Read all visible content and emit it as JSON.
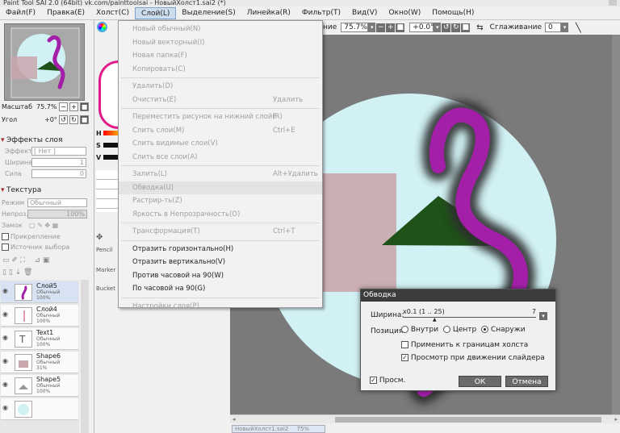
{
  "window": {
    "title": "Paint Tool SAI 2.0 (64bit) vk.com/painttoolsai - НовыйХолст1.sai2 (*)"
  },
  "menubar": [
    "Файл(F)",
    "Правка(E)",
    "Холст(C)",
    "Слой(L)",
    "Выделение(S)",
    "Линейка(R)",
    "Фильтр(T)",
    "Вид(V)",
    "Окно(W)",
    "Помощь(H)"
  ],
  "navigator": {
    "zoom_label": "Масштаб",
    "zoom_value": "75.7%",
    "angle_label": "Угол",
    "angle_value": "+0°"
  },
  "layer_effects": {
    "header": "Эффекты слоя",
    "effect_label": "Эффект",
    "effect_value": "[ Нет ]",
    "width_label": "Ширина",
    "width_value": "1",
    "strength_label": "Сила",
    "strength_value": "0"
  },
  "texture": {
    "header": "Текстура",
    "mode_label": "Режим",
    "mode_value": "Обычный",
    "opacity_label": "Непроз.",
    "opacity_value": "100%",
    "lock_label": "Замок",
    "clip_label": "Прикрепление",
    "source_label": "Источник выбора"
  },
  "layers": [
    {
      "name": "Слой5",
      "mode": "Обычный",
      "opacity": "100%",
      "selected": true
    },
    {
      "name": "Слой4",
      "mode": "Обычный",
      "opacity": "100%",
      "selected": false
    },
    {
      "name": "Text1",
      "mode": "Обычный",
      "opacity": "100%",
      "selected": false
    },
    {
      "name": "Shape6",
      "mode": "Обычный",
      "opacity": "31%",
      "selected": false
    },
    {
      "name": "Shape5",
      "mode": "Обычный",
      "opacity": "100%",
      "selected": false
    }
  ],
  "color_panel": {
    "h": "H",
    "s": "S",
    "v": "V"
  },
  "tool_labels": {
    "pencil": "Pencil",
    "marker": "Marker",
    "bucket": "Bucket"
  },
  "toolbar": {
    "zoom_tail": "ние",
    "zoom_value": "75.7%",
    "angle_value": "+0.0°",
    "smoothing_label": "Сглаживание",
    "smoothing_value": "0"
  },
  "layer_menu": {
    "groups": [
      [
        {
          "label": "Новый обычный(N)",
          "shortcut": "",
          "enabled": false
        },
        {
          "label": "Новый векторный(I)",
          "shortcut": "",
          "enabled": false
        },
        {
          "label": "Новая папка(F)",
          "shortcut": "",
          "enabled": false
        },
        {
          "label": "Копировать(C)",
          "shortcut": "",
          "enabled": false
        }
      ],
      [
        {
          "label": "Удалить(D)",
          "shortcut": "",
          "enabled": false
        },
        {
          "label": "Очистить(E)",
          "shortcut": "Удалить",
          "enabled": false
        }
      ],
      [
        {
          "label": "Переместить рисунок на нижний слой(R)",
          "shortcut": "F",
          "enabled": false
        },
        {
          "label": "Слить слои(M)",
          "shortcut": "Ctrl+E",
          "enabled": false
        },
        {
          "label": "Слить видимые слои(V)",
          "shortcut": "",
          "enabled": false
        },
        {
          "label": "Слить все слои(A)",
          "shortcut": "",
          "enabled": false
        }
      ],
      [
        {
          "label": "Залить(L)",
          "shortcut": "Alt+Удалить",
          "enabled": false
        },
        {
          "label": "Обводка(U)",
          "shortcut": "",
          "enabled": false,
          "hover": true
        },
        {
          "label": "Растрир-ть(Z)",
          "shortcut": "",
          "enabled": false
        },
        {
          "label": "Яркость в Непрозрачность(O)",
          "shortcut": "",
          "enabled": false
        }
      ],
      [
        {
          "label": "Трансформация(T)",
          "shortcut": "Ctrl+T",
          "enabled": false
        }
      ],
      [
        {
          "label": "Отразить горизонтально(H)",
          "shortcut": "",
          "enabled": true
        },
        {
          "label": "Отразить вертикально(V)",
          "shortcut": "",
          "enabled": true
        },
        {
          "label": "Против часовой на 90(W)",
          "shortcut": "",
          "enabled": true
        },
        {
          "label": "По часовой на 90(G)",
          "shortcut": "",
          "enabled": true
        }
      ],
      [
        {
          "label": "Настройки слоя(P)",
          "shortcut": "",
          "enabled": false
        }
      ]
    ]
  },
  "stroke_dialog": {
    "title": "Обводка",
    "width_label": "Ширина:",
    "width_range": "x0.1 (1 .. 25)",
    "width_value": "7",
    "position_label": "Позиция:",
    "position_options": [
      "Внутри",
      "Центр",
      "Снаружи"
    ],
    "position_selected": "Снаружи",
    "apply_canvas_edges_label": "Применить к границам холста",
    "apply_canvas_edges_checked": false,
    "preview_slider_label": "Просмотр при движении слайдера",
    "preview_slider_checked": true,
    "preview_label": "Просм.",
    "preview_checked": true,
    "ok_label": "ОК",
    "cancel_label": "Отмена"
  },
  "status": {
    "doc_tab": "НовыйХолст1.sai2",
    "doc_zoom": "75%"
  },
  "colors": {
    "canvas_bg": "#7a7a7a",
    "circle": "#d1f1f5",
    "rect": "#c9a7ad",
    "triangle": "#1e5218",
    "squiggle": "#a31fa8",
    "squiggle_glow": "#3a2a3a"
  }
}
